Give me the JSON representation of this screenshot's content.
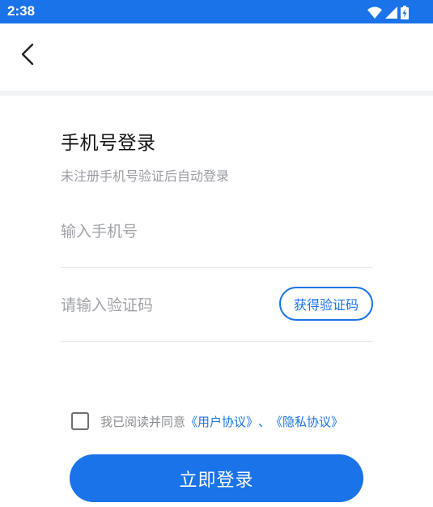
{
  "status_bar": {
    "time": "2:38",
    "icons": [
      "wifi-icon",
      "signal-icon",
      "battery-charging-icon"
    ],
    "background_color": "#1a73e8"
  },
  "nav": {
    "back_icon": "chevron-left-icon"
  },
  "login": {
    "title": "手机号登录",
    "subtitle": "未注册手机号验证后自动登录",
    "phone_placeholder": "输入手机号",
    "phone_value": "",
    "code_placeholder": "请输入验证码",
    "code_value": "",
    "get_code_label": "获得验证码"
  },
  "agreement": {
    "checked": false,
    "text": "我已阅读并同意",
    "user_agreement": "《用户协议》",
    "separator": "、",
    "privacy_policy": "《隐私协议》"
  },
  "submit": {
    "label": "立即登录",
    "color": "#1a73e8"
  }
}
